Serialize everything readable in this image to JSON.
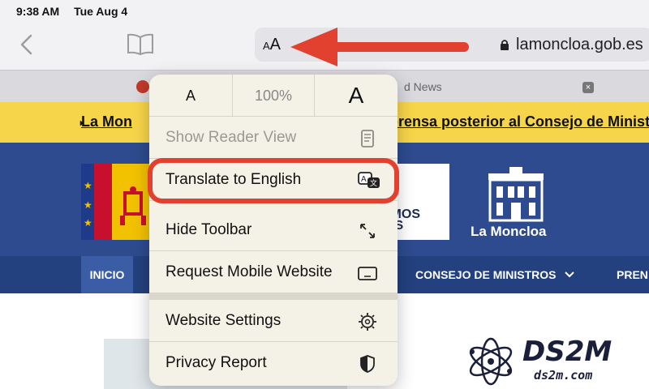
{
  "status_bar": {
    "time": "9:38 AM",
    "date": "Tue Aug 4"
  },
  "toolbar": {
    "aa_label_small": "A",
    "aa_label_large": "A",
    "url": "lamoncloa.gob.es"
  },
  "tab": {
    "title_fragment": "d News",
    "close": "×"
  },
  "ticker": {
    "left_text": "La Mon",
    "right_text": "prensa posterior al Consejo de Ministr"
  },
  "header": {
    "banner_lines": [
      "E",
      "AMOS",
      "OS"
    ],
    "site_name": "La Moncloa"
  },
  "nav": {
    "home": "INICIO",
    "council": "CONSEJO DE MINISTROS",
    "press": "PREN"
  },
  "menu": {
    "font_smaller": "A",
    "zoom": "100%",
    "font_larger": "A",
    "items": [
      {
        "label": "Show Reader View",
        "icon": "reader-icon",
        "enabled": false
      },
      {
        "label": "Translate to English",
        "icon": "translate-icon",
        "enabled": true
      },
      {
        "label": "Hide Toolbar",
        "icon": "expand-arrows-icon",
        "enabled": true
      },
      {
        "label": "Request Mobile Website",
        "icon": "mobile-device-icon",
        "enabled": true
      },
      {
        "label": "Website Settings",
        "icon": "gear-icon",
        "enabled": true
      },
      {
        "label": "Privacy Report",
        "icon": "shield-icon",
        "enabled": true
      }
    ]
  },
  "watermark": {
    "name": "DS2M",
    "url": "ds2m.com"
  },
  "colors": {
    "annotation_red": "#e2412f",
    "ticker_yellow": "#f7d54a",
    "header_blue": "#2d4b8e",
    "menu_bg": "#f4f2e6"
  }
}
